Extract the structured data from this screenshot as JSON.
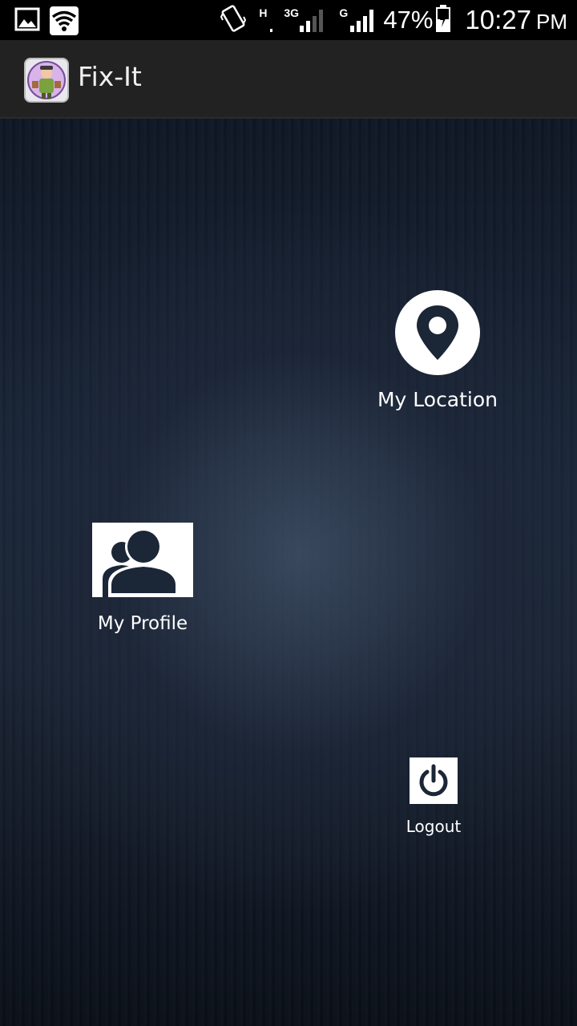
{
  "status_bar": {
    "battery": "47%",
    "time": "10:27",
    "ampm": "PM",
    "network_1_type": "H",
    "network_2_type": "3G",
    "network_3_type": "G",
    "icons": [
      "image-icon",
      "wifi-icon",
      "vibrate-icon",
      "signal-icon",
      "battery-charging-icon"
    ]
  },
  "action_bar": {
    "title": "Fix-It",
    "icon": "app-logo-icon"
  },
  "menu": {
    "location_label": "My Location",
    "profile_label": "My Profile",
    "logout_label": "Logout"
  },
  "colors": {
    "background_dark": "#0f1725",
    "background_mid": "#2a3a50",
    "action_bar": "#222222",
    "tile_white": "#ffffff",
    "icon_navy": "#1b2637"
  }
}
